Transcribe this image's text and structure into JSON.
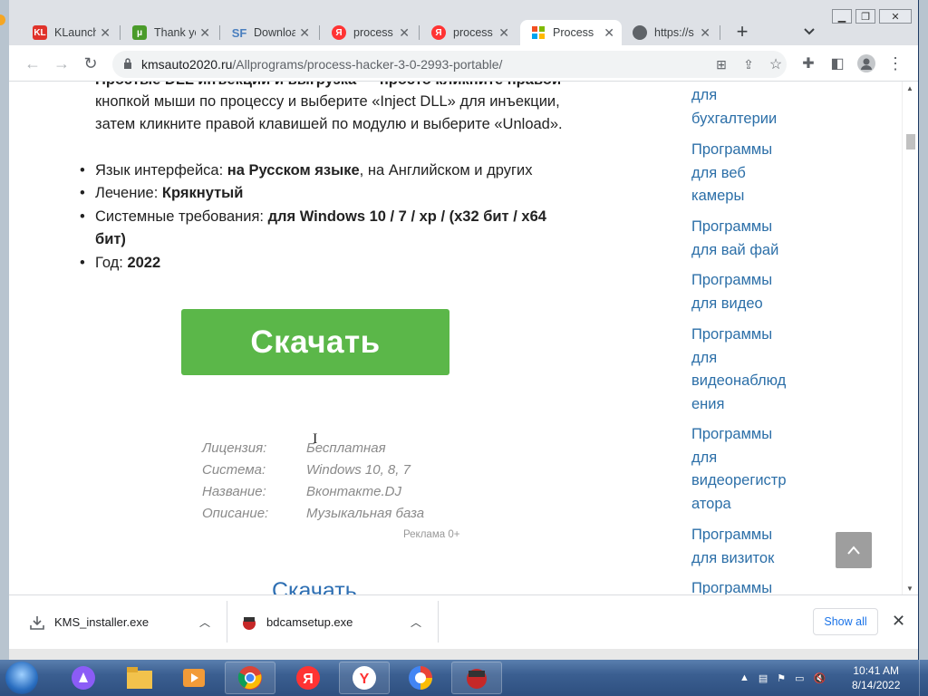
{
  "browser": {
    "tabs": [
      {
        "title": "KLaunch",
        "favicon": "kl-icon",
        "favicon_text": "KL",
        "color": "#e0322a"
      },
      {
        "title": "Thank yo",
        "favicon": "utorrent-icon",
        "favicon_text": "μ",
        "color": "#4a9b2a"
      },
      {
        "title": "Downloa",
        "favicon": "sourceforge-icon",
        "favicon_text": "SF",
        "color": "#4a7fbf"
      },
      {
        "title": "process",
        "favicon": "yandex-icon",
        "favicon_text": "Я",
        "color": "#f33"
      },
      {
        "title": "process",
        "favicon": "yandex-icon",
        "favicon_text": "Я",
        "color": "#f33"
      },
      {
        "title": "Process",
        "favicon": "windows-icon",
        "favicon_text": "",
        "color": "#0078d7",
        "active": true
      },
      {
        "title": "https://s",
        "favicon": "globe-icon",
        "favicon_text": "",
        "color": "#5f6368"
      }
    ],
    "new_tab": "+",
    "url_host": "kmsauto2020.ru",
    "url_path": "/Allprograms/process-hacker-3-0-2993-portable/"
  },
  "content": {
    "intro_cut": "Простые DLL инъекции и выгрузка — просто кликните правой",
    "intro_line2": "кнопкой мыши по процессу и выберите «Inject DLL» для инъекции,",
    "intro_line3": "затем кликните правой клавишей по модулю и выберите «Unload».",
    "bullets": [
      {
        "label": "Язык интерфейса: ",
        "bold": "на Русском языке",
        "rest": ", на Английском и других"
      },
      {
        "label": "Лечение: ",
        "bold": "Крякнутый",
        "rest": ""
      },
      {
        "label": "Системные требования: ",
        "bold": "для Windows 10 / 7 / xp / (x32 бит / x64",
        "rest": ""
      },
      {
        "label": "Год: ",
        "bold": "2022",
        "rest": ""
      }
    ],
    "bullet3_cont": "бит)",
    "download_button": "Скачать",
    "ad": {
      "rows": [
        {
          "key": "Лицензия:",
          "value": "Бесплатная"
        },
        {
          "key": "Система:",
          "value": "Windows 10, 8, 7"
        },
        {
          "key": "Название:",
          "value": "Вконтакте.DJ"
        },
        {
          "key": "Описание:",
          "value": "Музыкальная база"
        }
      ],
      "reklama": "Реклама 0+",
      "download_link": "Скачать"
    }
  },
  "sidebar": {
    "links": [
      "для\nбухгалтерии",
      "Программы\nдля веб\nкамеры",
      "Программы\nдля вай фай",
      "Программы\nдля видео",
      "Программы\nдля\nвидеонаблюд\nения",
      "Программы\nдля\nвидеорегистр\nатора",
      "Программы\nдля визиток",
      "Программы"
    ]
  },
  "downloads": {
    "items": [
      {
        "name": "KMS_installer.exe"
      },
      {
        "name": "bdcamsetup.exe"
      }
    ],
    "show_all": "Show all"
  },
  "taskbar": {
    "time": "10:41 AM",
    "date": "8/14/2022"
  }
}
